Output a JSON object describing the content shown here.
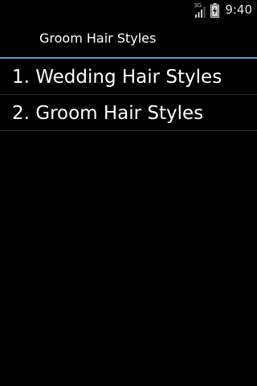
{
  "status_bar": {
    "network_type": "3G",
    "time": "9:40",
    "signal_icon": "signal-icon",
    "battery_icon": "battery-charging-icon"
  },
  "title_bar": {
    "title": "Groom Hair Styles",
    "accent_color": "#5aa5d4"
  },
  "list": {
    "items": [
      {
        "label": "1. Wedding Hair Styles"
      },
      {
        "label": "2. Groom Hair Styles"
      }
    ]
  }
}
